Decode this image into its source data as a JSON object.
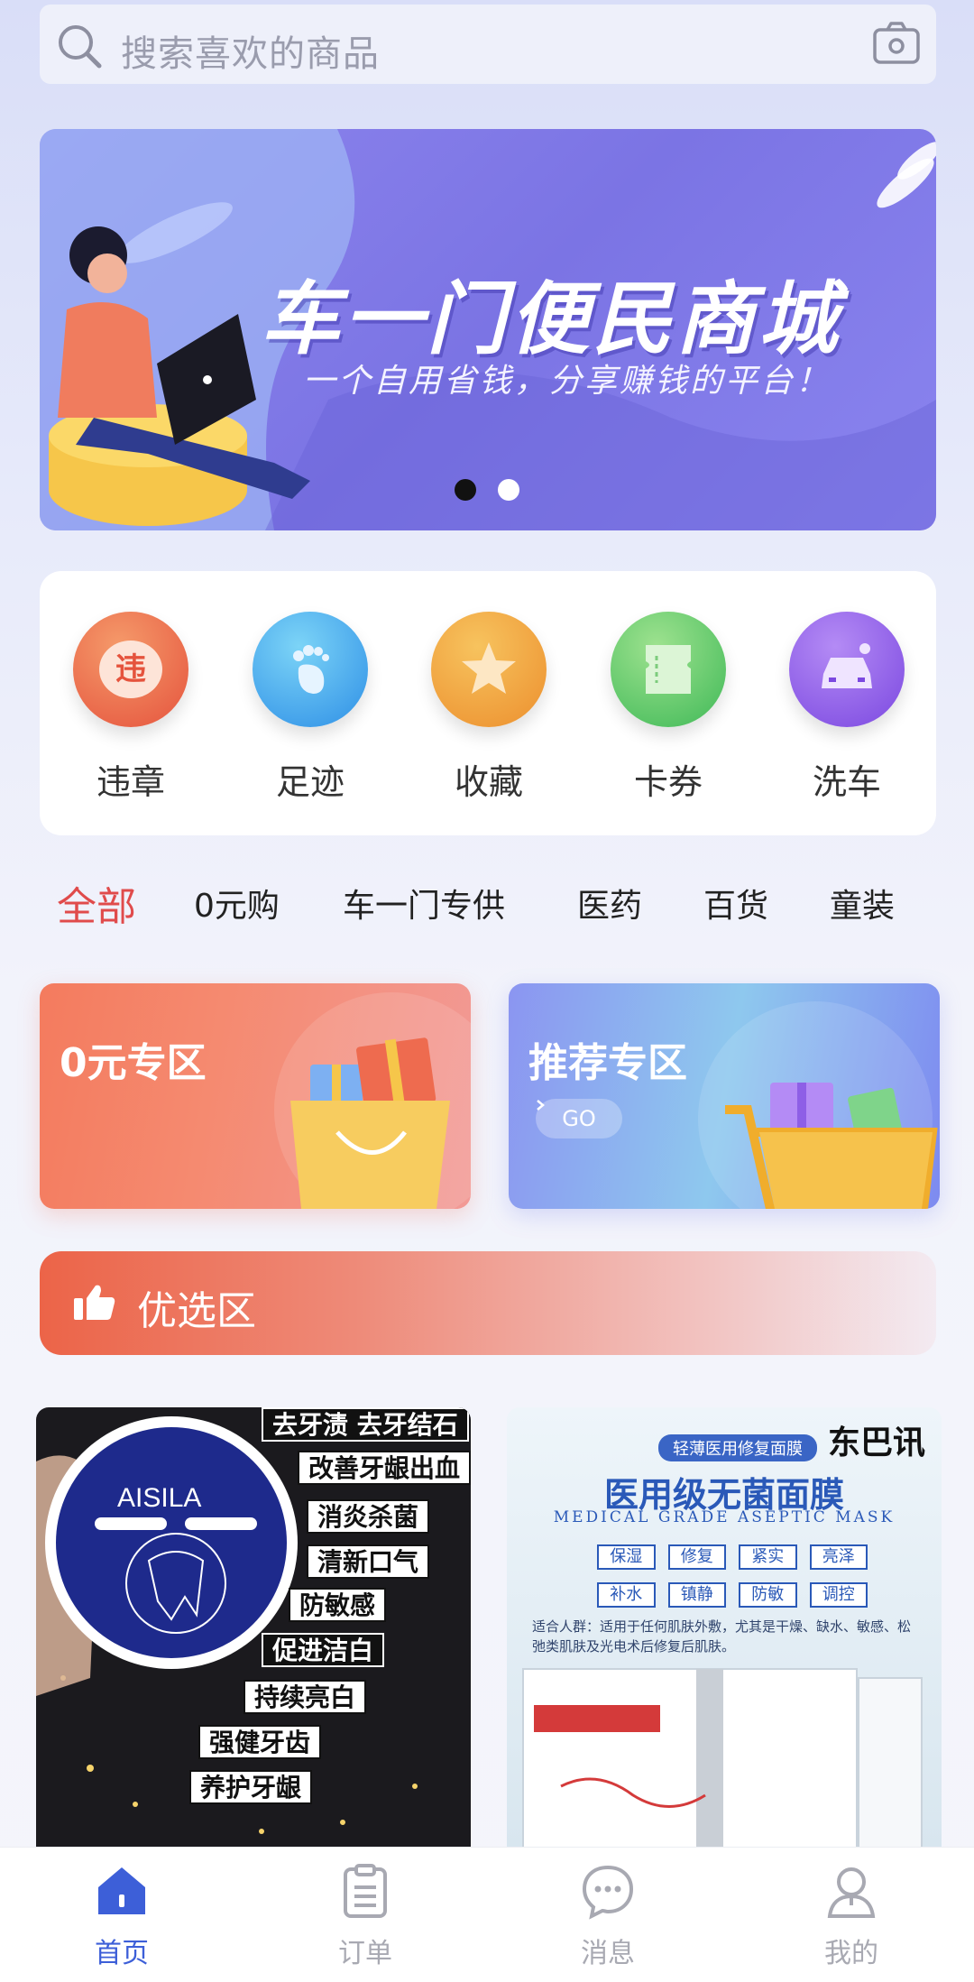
{
  "search": {
    "placeholder": "搜索喜欢的商品"
  },
  "banner": {
    "title": "车一门便民商城",
    "subtitle": "一个自用省钱，分享赚钱的平台！",
    "page_count": 2,
    "active_page": 1
  },
  "quick_actions": [
    {
      "label": "违章",
      "icon": "violation-icon",
      "glyph": "违",
      "color": "#ef6a4c"
    },
    {
      "label": "足迹",
      "icon": "footprint-icon",
      "color": "#3fa3ec"
    },
    {
      "label": "收藏",
      "icon": "star-icon",
      "color": "#f1a63a"
    },
    {
      "label": "卡券",
      "icon": "ticket-icon",
      "color": "#61c765"
    },
    {
      "label": "洗车",
      "icon": "car-wash-icon",
      "color": "#8e5fe6"
    }
  ],
  "categories": [
    "全部",
    "0元购",
    "车一门专供",
    "医药",
    "百货",
    "童装"
  ],
  "active_category": "全部",
  "promos": {
    "left": {
      "title": "0元专区"
    },
    "right": {
      "title": "推荐专区",
      "go_label": "GO"
    }
  },
  "preferred": {
    "label": "优选区"
  },
  "products": [
    {
      "brand": "AISILA",
      "tags": [
        "去牙渍 去牙结石",
        "改善牙龈出血",
        "消炎杀菌",
        "清新口气",
        "防敏感",
        "促进洁白",
        "持续亮白",
        "强健牙齿",
        "养护牙龈"
      ]
    },
    {
      "brand": "东巴讯",
      "pill": "轻薄医用修复面膜",
      "title": "医用级无菌面膜",
      "subtitle": "MEDICAL GRADE ASEPTIC MASK",
      "features": [
        "保湿",
        "修复",
        "紧实",
        "亮泽",
        "补水",
        "镇静",
        "防敏",
        "调控"
      ],
      "audience": "适合人群：适用于任何肌肤外敷，尤其是干燥、缺水、敏感、松弛类肌肤及光电术后修复后肌肤。"
    }
  ],
  "nav": [
    {
      "label": "首页",
      "icon": "home-icon",
      "active": true
    },
    {
      "label": "订单",
      "icon": "orders-icon",
      "active": false
    },
    {
      "label": "消息",
      "icon": "message-icon",
      "active": false
    },
    {
      "label": "我的",
      "icon": "profile-icon",
      "active": false
    }
  ],
  "colors": {
    "accent": "#3d5fd8",
    "category_active": "#e04b4b",
    "preferred_bar": "#ec6448"
  }
}
